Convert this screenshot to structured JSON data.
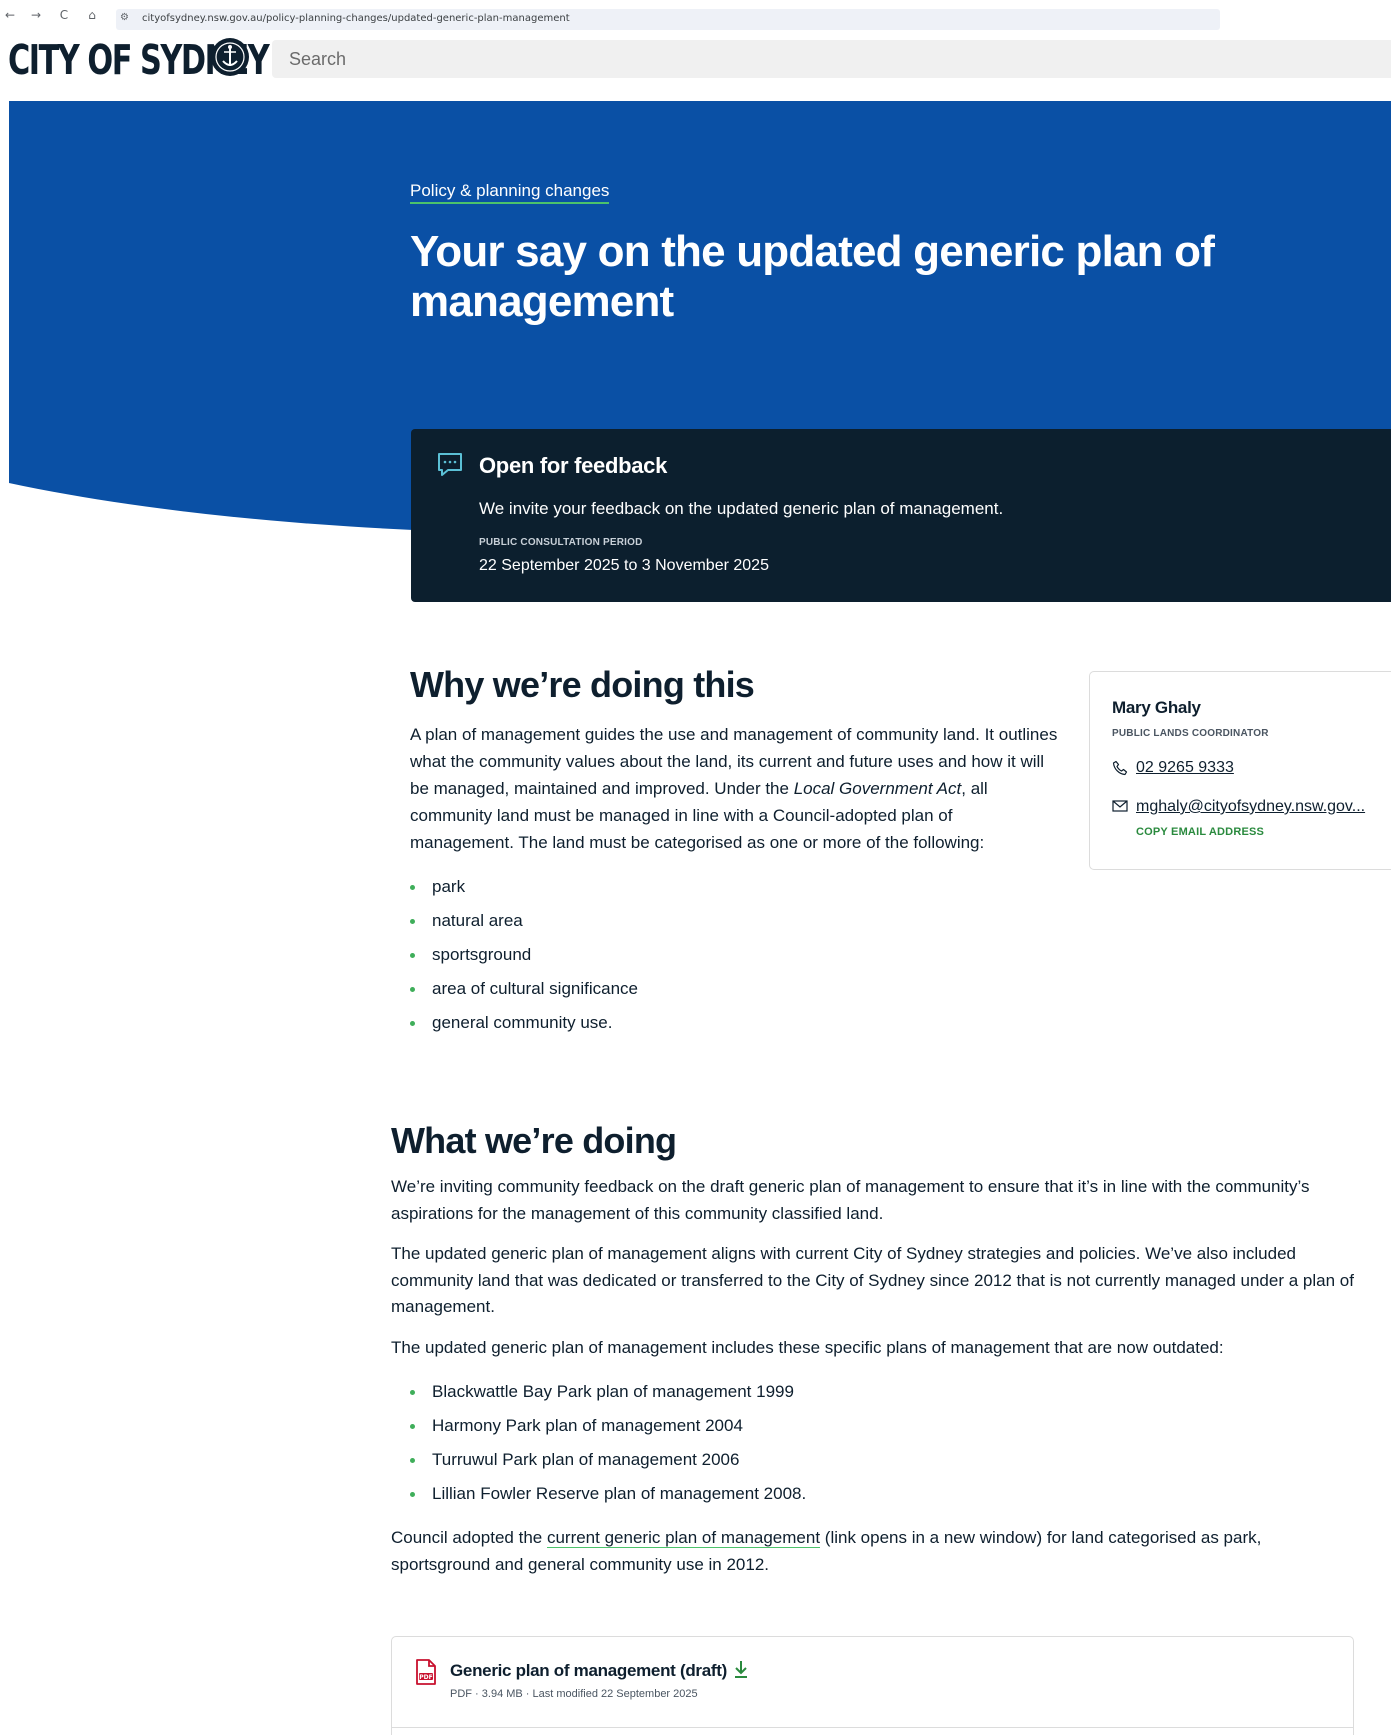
{
  "browser": {
    "back": "←",
    "forward": "→",
    "reload": "C",
    "home": "⌂",
    "url": "cityofsydney.nsw.gov.au/policy-planning-changes/updated-generic-plan-management"
  },
  "header": {
    "logo_text": "CITY OF SYDNEY",
    "search_placeholder": "Search"
  },
  "hero": {
    "breadcrumb": "Policy & planning changes",
    "title": "Your say on the updated generic plan of management"
  },
  "feedback": {
    "title": "Open for feedback",
    "description": "We invite your feedback on the updated generic plan of management.",
    "period_label": "PUBLIC CONSULTATION PERIOD",
    "period": "22 September 2025 to 3 November 2025"
  },
  "why": {
    "heading": "Why we’re doing this",
    "para_before": "A plan of management guides the use and management of community land. It outlines what the community values about the land, its current and future uses and how it will be managed, maintained and improved. Under the ",
    "para_italic": "Local Government Act",
    "para_after": ", all community land must be managed in line with a Council-adopted plan of management. The land must be categorised as one or more of the following:",
    "categories": [
      "park",
      "natural area",
      "sportsground",
      "area of cultural significance",
      "general community use."
    ]
  },
  "contact": {
    "name": "Mary Ghaly",
    "role": "PUBLIC LANDS COORDINATOR",
    "phone": "02 9265 9333",
    "email": "mghaly@cityofsydney.nsw.gov...",
    "copy_label": "COPY EMAIL ADDRESS"
  },
  "what": {
    "heading": "What we’re doing",
    "para1": "We’re inviting community feedback on the draft generic plan of management to ensure that it’s in line with the community’s aspirations for the management of this community classified land.",
    "para2": "The updated generic plan of management aligns with current City of Sydney strategies and policies. We’ve also included community land that was dedicated or transferred to the City of Sydney since 2012 that is not currently managed under a plan of management.",
    "para3": "The updated generic plan of management includes these specific plans of management that are now outdated:",
    "plans": [
      "Blackwattle Bay Park plan of management 1999",
      "Harmony Park plan of management 2004",
      "Turruwul Park plan of management 2006",
      "Lillian Fowler Reserve plan of management 2008."
    ],
    "para4_before": "Council adopted the ",
    "para4_link": "current generic plan of management",
    "para4_after": " (link opens in a new window) for land categorised as park, sportsground and general community use in 2012."
  },
  "document": {
    "title": "Generic plan of management (draft)",
    "meta": "PDF · 3.94 MB · Last modified 22 September 2025",
    "icon_label": "PDF"
  },
  "colors": {
    "hero_blue": "#0a50a5",
    "banner_navy": "#0c1f2e",
    "accent_green": "#3fae5a",
    "pdf_red": "#c8102e"
  }
}
